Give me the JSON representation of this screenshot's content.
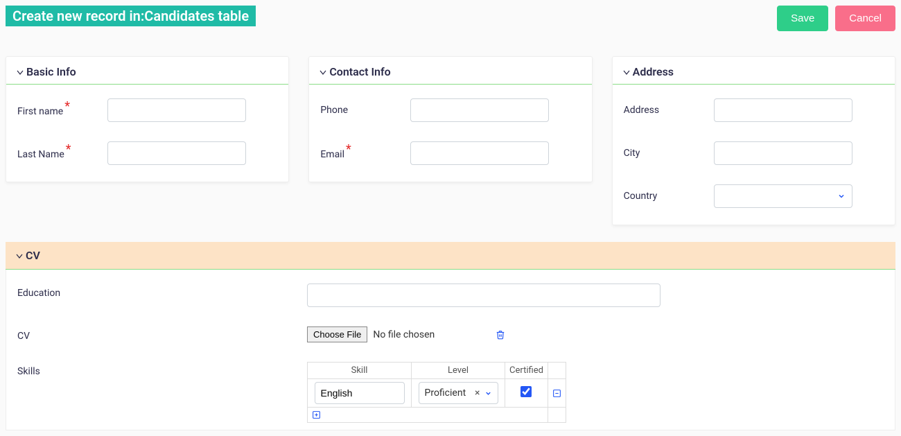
{
  "header": {
    "title": "Create new record in:Candidates table",
    "save": "Save",
    "cancel": "Cancel"
  },
  "sections": {
    "basic": {
      "title": "Basic Info",
      "first_name_label": "First name",
      "last_name_label": "Last Name",
      "first_name_value": "",
      "last_name_value": ""
    },
    "contact": {
      "title": "Contact Info",
      "phone_label": "Phone",
      "email_label": "Email",
      "phone_value": "",
      "email_value": ""
    },
    "address": {
      "title": "Address",
      "address_label": "Address",
      "city_label": "City",
      "country_label": "Country",
      "address_value": "",
      "city_value": "",
      "country_value": ""
    },
    "cv": {
      "title": "CV",
      "education_label": "Education",
      "education_value": "",
      "cv_label": "CV",
      "choose_file": "Choose File",
      "no_file": "No file chosen",
      "skills_label": "Skills",
      "skills_table": {
        "col_skill": "Skill",
        "col_level": "Level",
        "col_certified": "Certified",
        "rows": [
          {
            "skill": "English",
            "level": "Proficient",
            "certified": true
          }
        ]
      }
    }
  }
}
